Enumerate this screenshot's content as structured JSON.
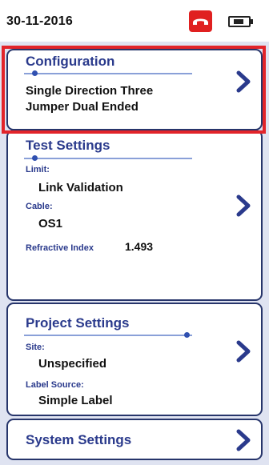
{
  "status": {
    "date": "30-11-2016",
    "icons": [
      "phone-hangup-icon",
      "battery-icon"
    ]
  },
  "configuration": {
    "title": "Configuration",
    "value_line1": "Single Direction Three",
    "value_line2": "Jumper Dual Ended"
  },
  "test_settings": {
    "title": "Test Settings",
    "limit_label": "Limit:",
    "limit_value": "Link Validation",
    "cable_label": "Cable:",
    "cable_value": "OS1",
    "refractive_label": "Refractive Index",
    "refractive_value": "1.493"
  },
  "project_settings": {
    "title": "Project Settings",
    "site_label": "Site:",
    "site_value": "Unspecified",
    "label_source_label": "Label Source:",
    "label_source_value": "Simple Label"
  },
  "system_settings": {
    "title": "System Settings"
  },
  "colors": {
    "highlight": "#e2242a",
    "title_blue": "#2a3a8c",
    "panel_bg": "#dfe3f1",
    "phone_badge": "#e02020"
  }
}
